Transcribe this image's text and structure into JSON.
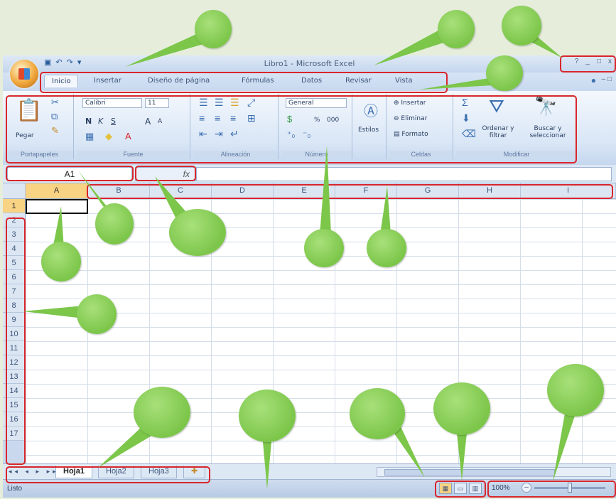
{
  "window": {
    "title": "Libro1 - Microsoft Excel",
    "qat_icons": [
      "save-icon",
      "undo-icon",
      "redo-icon"
    ],
    "controls": [
      "?",
      "_",
      "□",
      "x"
    ]
  },
  "tabs": [
    "Inicio",
    "Insertar",
    "Diseño de página",
    "Fórmulas",
    "Datos",
    "Revisar",
    "Vista"
  ],
  "ribbon": {
    "clipboard": {
      "label": "Portapapeles",
      "paste": "Pegar"
    },
    "font": {
      "label": "Fuente",
      "name": "Calibri",
      "size": "11",
      "bold": "N",
      "italic": "K",
      "underline": "S",
      "grow": "A",
      "shrink": "A"
    },
    "alignment": {
      "label": "Alineación"
    },
    "number": {
      "label": "Número",
      "format": "General",
      "percent": "%",
      "thousands": "000"
    },
    "styles": {
      "label": "Estilos"
    },
    "cells": {
      "label": "Celdas",
      "insert": "Insertar",
      "delete": "Eliminar",
      "format": "Formato"
    },
    "editing": {
      "label": "Modificar",
      "sort": "Ordenar y filtrar",
      "find": "Buscar y seleccionar"
    }
  },
  "formula_bar": {
    "name_box": "A1",
    "fx": "fx",
    "value": ""
  },
  "columns": [
    "A",
    "B",
    "C",
    "D",
    "E",
    "F",
    "G",
    "H",
    "I"
  ],
  "rows": [
    "1",
    "2",
    "3",
    "4",
    "5",
    "6",
    "7",
    "8",
    "9",
    "10",
    "11",
    "12",
    "13",
    "14",
    "15",
    "16",
    "17"
  ],
  "sheets": [
    "Hoja1",
    "Hoja2",
    "Hoja3"
  ],
  "status": {
    "text": "Listo",
    "zoom": "100%"
  },
  "colors": {
    "highlight": "#d8262c",
    "callout": "#7cc64a",
    "selected": "#f8d383"
  }
}
